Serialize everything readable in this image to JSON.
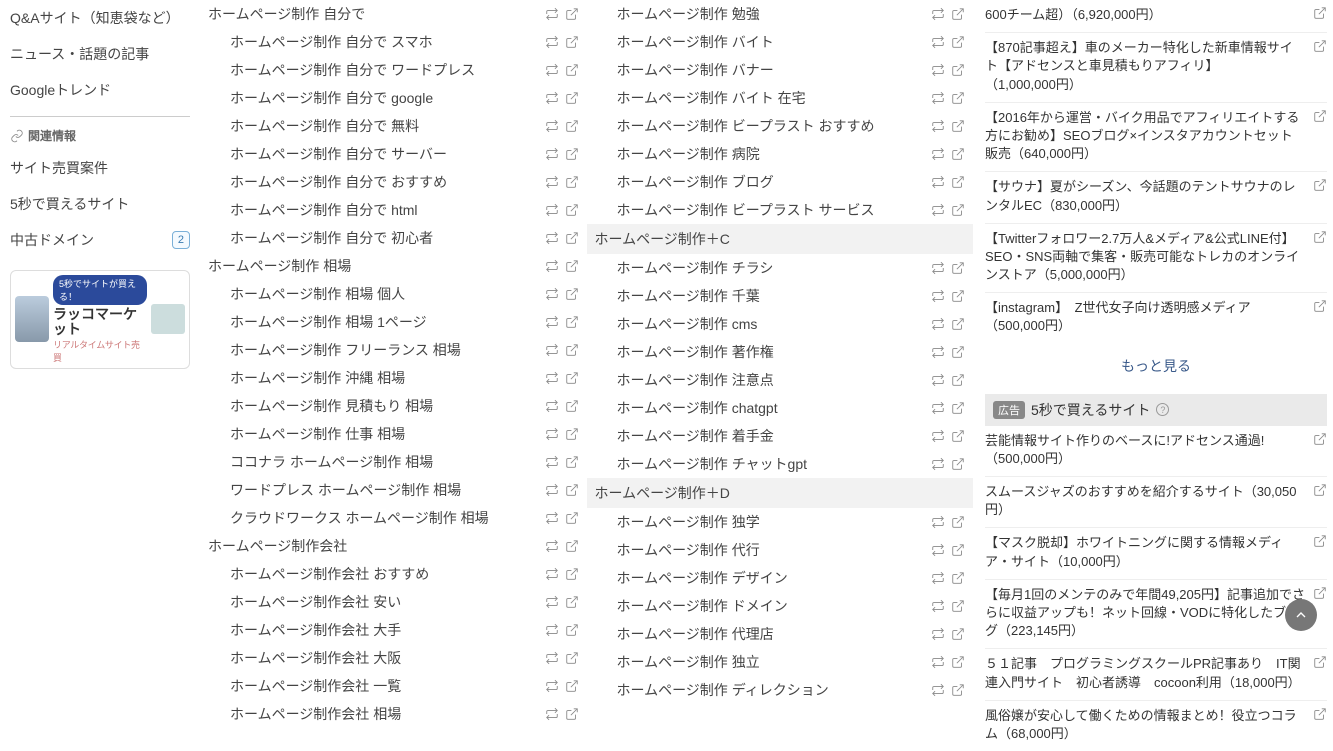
{
  "sidebar": {
    "items": [
      "Q&Aサイト（知恵袋など）",
      "ニュース・話題の記事",
      "Googleトレンド"
    ],
    "relatedHeading": "関連情報",
    "related": [
      {
        "label": "サイト売買案件",
        "badge": null
      },
      {
        "label": "5秒で買えるサイト",
        "badge": null
      },
      {
        "label": "中古ドメイン",
        "badge": "2"
      }
    ],
    "banner": {
      "tag": "5秒でサイトが買える！",
      "title": "ラッコマーケット",
      "sub": "リアルタイムサイト売買"
    }
  },
  "leftCol": {
    "groups": [
      {
        "header": "ホームページ制作 自分で",
        "items": [
          "ホームページ制作 自分で スマホ",
          "ホームページ制作 自分で ワードプレス",
          "ホームページ制作 自分で google",
          "ホームページ制作 自分で 無料",
          "ホームページ制作 自分で サーバー",
          "ホームページ制作 自分で おすすめ",
          "ホームページ制作 自分で html",
          "ホームページ制作 自分で 初心者"
        ]
      },
      {
        "header": "ホームページ制作 相場",
        "items": [
          "ホームページ制作 相場 個人",
          "ホームページ制作 相場 1ページ",
          "ホームページ制作 フリーランス 相場",
          "ホームページ制作 沖縄 相場",
          "ホームページ制作 見積もり 相場",
          "ホームページ制作 仕事 相場",
          "ココナラ ホームページ制作 相場",
          "ワードプレス ホームページ制作 相場",
          "クラウドワークス ホームページ制作 相場"
        ]
      },
      {
        "header": "ホームページ制作会社",
        "items": [
          "ホームページ制作会社 おすすめ",
          "ホームページ制作会社 安い",
          "ホームページ制作会社 大手",
          "ホームページ制作会社 大阪",
          "ホームページ制作会社 一覧",
          "ホームページ制作会社 相場"
        ]
      }
    ]
  },
  "midCol": {
    "groups": [
      {
        "header": null,
        "items": [
          "ホームページ制作 勉強",
          "ホームページ制作 バイト",
          "ホームページ制作 バナー",
          "ホームページ制作 バイト 在宅",
          "ホームページ制作 ビープラスト おすすめ",
          "ホームページ制作 病院",
          "ホームページ制作 ブログ",
          "ホームページ制作 ビープラスト サービス"
        ]
      },
      {
        "header": "ホームページ制作＋C",
        "items": [
          "ホームページ制作 チラシ",
          "ホームページ制作 千葉",
          "ホームページ制作 cms",
          "ホームページ制作 著作権",
          "ホームページ制作 注意点",
          "ホームページ制作 chatgpt",
          "ホームページ制作 着手金",
          "ホームページ制作 チャットgpt"
        ]
      },
      {
        "header": "ホームページ制作＋D",
        "items": [
          "ホームページ制作 独学",
          "ホームページ制作 代行",
          "ホームページ制作 デザイン",
          "ホームページ制作 ドメイン",
          "ホームページ制作 代理店",
          "ホームページ制作 独立",
          "ホームページ制作 ディレクション"
        ]
      }
    ]
  },
  "right": {
    "ads1": [
      {
        "text": "600チーム超）",
        "price": "（6,920,000円）"
      },
      {
        "text": "【870記事超え】車のメーカー特化した新車情報サイト【アドセンスと車見積もりアフィリ】",
        "price": "（1,000,000円）"
      },
      {
        "text": "【2016年から運営・バイク用品でアフィリエイトする方にお勧め】SEOブログ×インスタアカウントセット販売",
        "price": "（640,000円）"
      },
      {
        "text": "【サウナ】夏がシーズン、今話題のテントサウナのレンタルEC",
        "price": "（830,000円）"
      },
      {
        "text": "【Twitterフォロワー2.7万人&メディア&公式LINE付】SEO・SNS両軸で集客・販売可能なトレカのオンラインストア",
        "price": "（5,000,000円）"
      },
      {
        "text": "【instagram】　Z世代女子向け透明感メディア",
        "price": "（500,000円）"
      }
    ],
    "moreLink": "もっと見る",
    "heading2": {
      "badge": "広告",
      "title": "5秒で買えるサイト"
    },
    "ads2": [
      {
        "text": "芸能情報サイト作りのベースに!アドセンス通過!",
        "price": "（500,000円）"
      },
      {
        "text": "スムースジャズのおすすめを紹介するサイト",
        "price": "（30,050円）"
      },
      {
        "text": "【マスク脱却】ホワイトニングに関する情報メディア・サイト",
        "price": "（10,000円）"
      },
      {
        "text": "【毎月1回のメンテのみで年間49,205円】記事追加でさらに収益アップも！ネット回線・VODに特化したブログ",
        "price": "（223,145円）"
      },
      {
        "text": "５１記事　プログラミングスクールPR記事あり　IT関連入門サイト　初心者誘導　cocoon利用",
        "price": "（18,000円）"
      },
      {
        "text": "風俗嬢が安心して働くための情報まとめ！役立つコラム",
        "price": "（68,000円）"
      }
    ]
  }
}
